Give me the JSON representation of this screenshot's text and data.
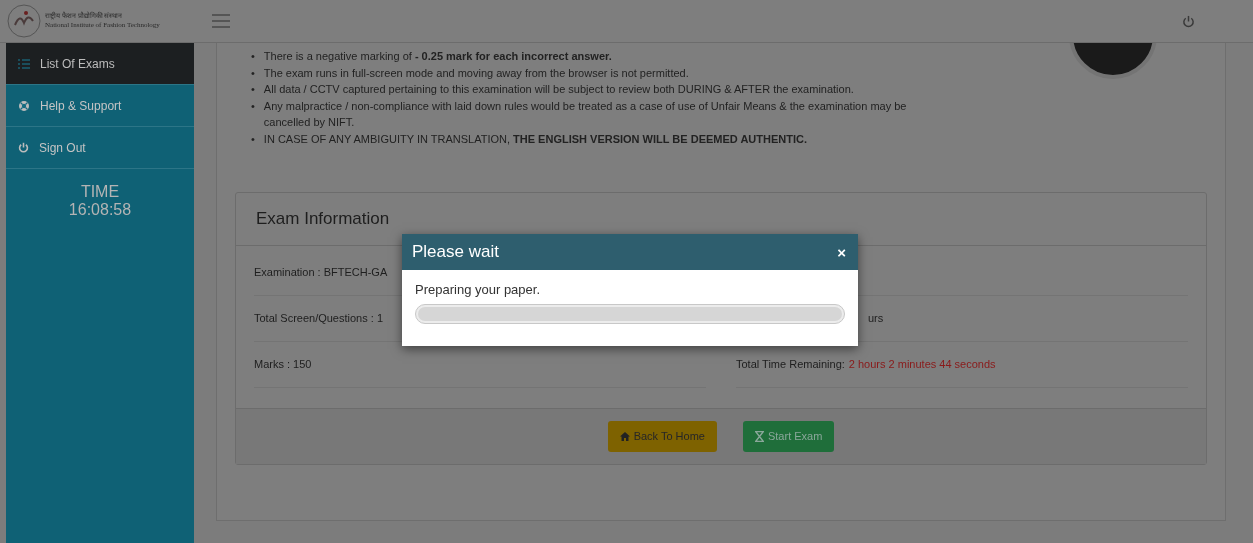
{
  "header": {
    "logo_hindi": "राष्ट्रीय फैशन प्रौद्योगिकी संस्थान",
    "logo_english": "National Institute of Fashion Technology"
  },
  "sidebar": {
    "items": [
      {
        "label": "List Of Exams",
        "selected": true
      },
      {
        "label": "Help & Support",
        "selected": false
      },
      {
        "label": "Sign Out",
        "selected": false
      }
    ],
    "time_label": "TIME",
    "time": "16:08:58"
  },
  "instructions": [
    {
      "bullet": "•",
      "text": "There is a negative marking of **- 0.25 mark for each incorrect answer.**"
    },
    {
      "bullet": "•",
      "text": "The exam runs in full-screen mode and moving away from the browser is not permitted."
    },
    {
      "bullet": "•",
      "text": "All data / CCTV captured pertaining to this examination will be subject to review both DURING & AFTER the examination."
    },
    {
      "bullet": "•",
      "text": "Any malpractice / non-compliance with laid down rules would be treated as a case of use of Unfair Means & the examination may be cancelled by NIFT."
    },
    {
      "bullet": "•",
      "text": "IN CASE OF ANY AMBIGUITY IN TRANSLATION, **THE ENGLISH VERSION WILL BE DEEMED AUTHENTIC.**"
    }
  ],
  "exam_info": {
    "title": "Exam Information",
    "rows": [
      {
        "left": "Examination : BFTECH-GA"
      },
      {
        "left": "Total Screen/Questions : 1",
        "right_label": "urs"
      },
      {
        "left": "Marks : 150",
        "right_label": "Total Time Remaining:",
        "right_value": "2 hours 2 minutes 44 seconds"
      }
    ],
    "buttons": [
      {
        "label": "Back To Home",
        "kind": "warning"
      },
      {
        "label": "Start Exam",
        "kind": "success"
      }
    ]
  },
  "modal": {
    "title": "Please wait",
    "close": "×",
    "message": "Preparing your paper.",
    "level": 1
  }
}
